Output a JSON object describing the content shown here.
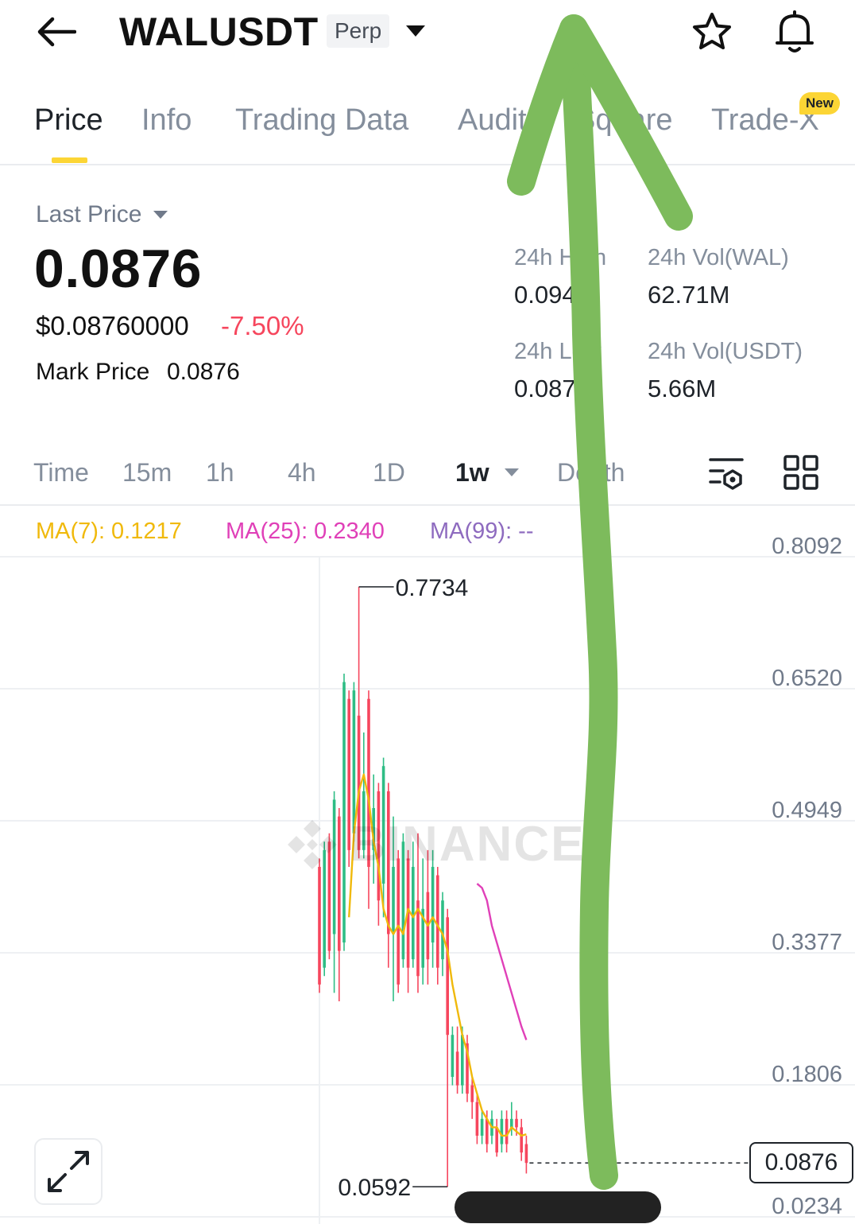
{
  "header": {
    "symbol": "WALUSDT",
    "contract_badge": "Perp"
  },
  "tabs": [
    {
      "label": "Price",
      "active": true
    },
    {
      "label": "Info",
      "active": false
    },
    {
      "label": "Trading Data",
      "active": false
    },
    {
      "label": "Audit",
      "active": false
    },
    {
      "label": "Square",
      "active": false
    },
    {
      "label": "Trade-X",
      "active": false,
      "badge": "New"
    }
  ],
  "price_panel": {
    "last_price_label": "Last Price",
    "last_price": "0.0876",
    "usd_price": "$0.08760000",
    "change_pct": "-7.50%",
    "mark_price_label": "Mark Price",
    "mark_price": "0.0876"
  },
  "stats": {
    "high_label": "24h High",
    "high_value": "0.094",
    "low_label": "24h Low",
    "low_value": "0.087",
    "vol_base_label": "24h Vol(WAL)",
    "vol_base_value": "62.71M",
    "vol_quote_label": "24h Vol(USDT)",
    "vol_quote_value": "5.66M"
  },
  "intervals": [
    {
      "label": "Time"
    },
    {
      "label": "15m"
    },
    {
      "label": "1h"
    },
    {
      "label": "4h"
    },
    {
      "label": "1D"
    },
    {
      "label": "1w",
      "active": true
    },
    {
      "label": "Depth"
    }
  ],
  "ma_legend": {
    "ma7": "MA(7): 0.1217",
    "ma25": "MA(25): 0.2340",
    "ma99": "MA(99): --"
  },
  "watermark": "BINANCE",
  "current_price_tag": "0.0876",
  "colors": {
    "up": "#2ebd85",
    "down": "#f6465d",
    "ma7": "#f0b90b",
    "ma25": "#e040b8",
    "ma99": "#8e6bbf",
    "accent": "#fcd535",
    "annotation": "#7dbb5c"
  },
  "chart_data": {
    "type": "candlestick",
    "interval": "1w",
    "y_ticks": [
      "0.8092",
      "0.6520",
      "0.4949",
      "0.3377",
      "0.1806",
      "0.0234"
    ],
    "ylim": [
      0.0234,
      0.8092
    ],
    "max_label": "0.7734",
    "min_label": "0.0592",
    "current_price": 0.0876,
    "candles": [
      {
        "o": 0.44,
        "c": 0.3,
        "h": 0.45,
        "l": 0.29
      },
      {
        "o": 0.32,
        "c": 0.46,
        "h": 0.47,
        "l": 0.31
      },
      {
        "o": 0.47,
        "c": 0.34,
        "h": 0.48,
        "l": 0.33
      },
      {
        "o": 0.36,
        "c": 0.52,
        "h": 0.53,
        "l": 0.29
      },
      {
        "o": 0.5,
        "c": 0.34,
        "h": 0.51,
        "l": 0.28
      },
      {
        "o": 0.35,
        "c": 0.66,
        "h": 0.67,
        "l": 0.34
      },
      {
        "o": 0.64,
        "c": 0.46,
        "h": 0.65,
        "l": 0.44
      },
      {
        "o": 0.48,
        "c": 0.65,
        "h": 0.66,
        "l": 0.47
      },
      {
        "o": 0.62,
        "c": 0.46,
        "h": 0.7734,
        "l": 0.45
      },
      {
        "o": 0.46,
        "c": 0.53,
        "h": 0.6,
        "l": 0.45
      },
      {
        "o": 0.64,
        "c": 0.44,
        "h": 0.65,
        "l": 0.39
      },
      {
        "o": 0.46,
        "c": 0.51,
        "h": 0.55,
        "l": 0.42
      },
      {
        "o": 0.53,
        "c": 0.4,
        "h": 0.54,
        "l": 0.37
      },
      {
        "o": 0.42,
        "c": 0.56,
        "h": 0.57,
        "l": 0.38
      },
      {
        "o": 0.53,
        "c": 0.36,
        "h": 0.54,
        "l": 0.32
      },
      {
        "o": 0.36,
        "c": 0.44,
        "h": 0.5,
        "l": 0.28
      },
      {
        "o": 0.45,
        "c": 0.3,
        "h": 0.46,
        "l": 0.29
      },
      {
        "o": 0.33,
        "c": 0.47,
        "h": 0.48,
        "l": 0.32
      },
      {
        "o": 0.45,
        "c": 0.32,
        "h": 0.46,
        "l": 0.29
      },
      {
        "o": 0.33,
        "c": 0.44,
        "h": 0.47,
        "l": 0.32
      },
      {
        "o": 0.4,
        "c": 0.31,
        "h": 0.48,
        "l": 0.29
      },
      {
        "o": 0.32,
        "c": 0.39,
        "h": 0.45,
        "l": 0.3
      },
      {
        "o": 0.41,
        "c": 0.33,
        "h": 0.46,
        "l": 0.3
      },
      {
        "o": 0.35,
        "c": 0.44,
        "h": 0.46,
        "l": 0.32
      },
      {
        "o": 0.43,
        "c": 0.32,
        "h": 0.44,
        "l": 0.3
      },
      {
        "o": 0.33,
        "c": 0.4,
        "h": 0.41,
        "l": 0.31
      },
      {
        "o": 0.38,
        "c": 0.24,
        "h": 0.39,
        "l": 0.0592
      },
      {
        "o": 0.19,
        "c": 0.24,
        "h": 0.25,
        "l": 0.18
      },
      {
        "o": 0.22,
        "c": 0.18,
        "h": 0.25,
        "l": 0.17
      },
      {
        "o": 0.18,
        "c": 0.24,
        "h": 0.25,
        "l": 0.17
      },
      {
        "o": 0.23,
        "c": 0.17,
        "h": 0.24,
        "l": 0.16
      },
      {
        "o": 0.18,
        "c": 0.16,
        "h": 0.19,
        "l": 0.14
      },
      {
        "o": 0.16,
        "c": 0.12,
        "h": 0.17,
        "l": 0.11
      },
      {
        "o": 0.12,
        "c": 0.14,
        "h": 0.15,
        "l": 0.11
      },
      {
        "o": 0.14,
        "c": 0.11,
        "h": 0.15,
        "l": 0.1
      },
      {
        "o": 0.12,
        "c": 0.14,
        "h": 0.15,
        "l": 0.11
      },
      {
        "o": 0.13,
        "c": 0.1,
        "h": 0.14,
        "l": 0.095
      },
      {
        "o": 0.11,
        "c": 0.14,
        "h": 0.15,
        "l": 0.1
      },
      {
        "o": 0.14,
        "c": 0.11,
        "h": 0.15,
        "l": 0.1
      },
      {
        "o": 0.13,
        "c": 0.14,
        "h": 0.16,
        "l": 0.12
      },
      {
        "o": 0.14,
        "c": 0.13,
        "h": 0.15,
        "l": 0.12
      },
      {
        "o": 0.13,
        "c": 0.1,
        "h": 0.14,
        "l": 0.09
      },
      {
        "o": 0.11,
        "c": 0.0876,
        "h": 0.12,
        "l": 0.075
      }
    ],
    "ma7": [
      null,
      null,
      null,
      null,
      null,
      null,
      0.38,
      0.48,
      0.53,
      0.55,
      0.52,
      0.47,
      0.44,
      0.39,
      0.37,
      0.36,
      0.37,
      0.36,
      0.39,
      0.38,
      0.39,
      0.38,
      0.37,
      0.38,
      0.37,
      0.36,
      0.34,
      0.3,
      0.27,
      0.24,
      0.22,
      0.19,
      0.17,
      0.15,
      0.14,
      0.13,
      0.13,
      0.12,
      0.12,
      0.13,
      0.125,
      0.12,
      0.1217
    ],
    "ma25": [
      null,
      null,
      null,
      null,
      null,
      null,
      null,
      null,
      null,
      null,
      null,
      null,
      null,
      null,
      null,
      null,
      null,
      null,
      null,
      null,
      null,
      null,
      null,
      null,
      0.42,
      0.415,
      0.4,
      0.37,
      0.35,
      0.33,
      0.31,
      0.29,
      0.27,
      0.25,
      0.234
    ]
  }
}
